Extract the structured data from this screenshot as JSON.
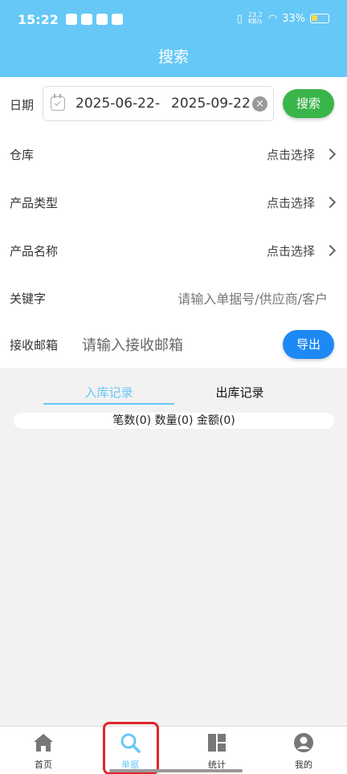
{
  "status_bar": {
    "time": "15:22",
    "network_speed": "23.2 KB/s",
    "battery": "33%"
  },
  "header": {
    "title": "搜索"
  },
  "form": {
    "date": {
      "label": "日期",
      "start": "2025-06-22",
      "separator": "-",
      "end": "2025-09-22"
    },
    "search_button": "搜索",
    "warehouse": {
      "label": "仓库",
      "value": "点击选择"
    },
    "product_type": {
      "label": "产品类型",
      "value": "点击选择"
    },
    "product_name": {
      "label": "产品名称",
      "value": "点击选择"
    },
    "keyword": {
      "label": "关键字",
      "placeholder": "请输入单据号/供应商/客户"
    },
    "email": {
      "label": "接收邮箱",
      "placeholder": "请输入接收邮箱"
    },
    "export_button": "导出"
  },
  "tabs": [
    {
      "label": "入库记录",
      "active": true
    },
    {
      "label": "出库记录",
      "active": false
    }
  ],
  "summary": "笔数(0) 数量(0) 金额(0)",
  "bottom_nav": [
    {
      "label": "首页",
      "icon": "home-icon"
    },
    {
      "label": "单据",
      "icon": "search-icon",
      "active": true
    },
    {
      "label": "统计",
      "icon": "dashboard-icon"
    },
    {
      "label": "我的",
      "icon": "user-icon"
    }
  ],
  "colors": {
    "accent": "#66c8f7",
    "search_button": "#3ab54a",
    "export_button": "#1e88f5",
    "highlight": "#e2242b"
  }
}
